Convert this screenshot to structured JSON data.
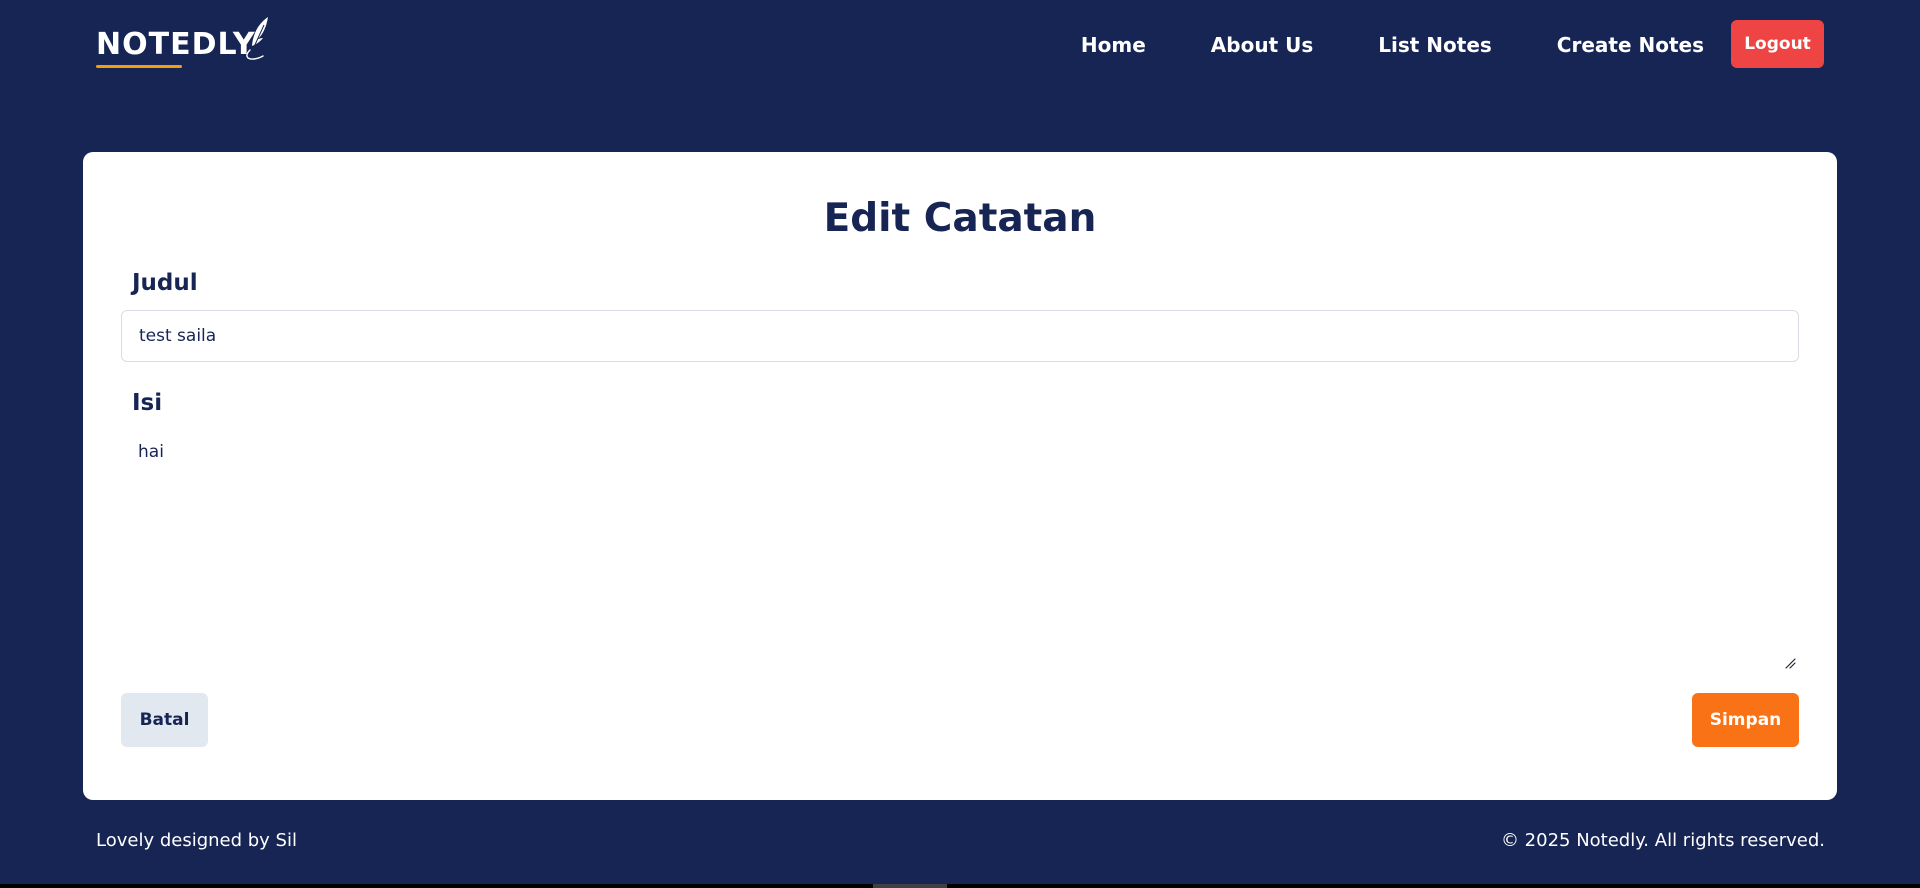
{
  "header": {
    "logo_text": "NOTEDLY",
    "nav": [
      {
        "label": "Home"
      },
      {
        "label": "About Us"
      },
      {
        "label": "List Notes"
      },
      {
        "label": "Create Notes"
      }
    ],
    "logout_label": "Logout"
  },
  "form": {
    "title": "Edit Catatan",
    "judul_label": "Judul",
    "judul_value": "test saila",
    "isi_label": "Isi",
    "isi_value": "hai",
    "cancel_label": "Batal",
    "save_label": "Simpan"
  },
  "footer": {
    "left_text": "Lovely designed by Sil",
    "right_text": "© 2025 Notedly. All rights reserved."
  },
  "colors": {
    "background": "#172554",
    "logout": "#ef4444",
    "save": "#f97316",
    "cancel": "#e2e8f0",
    "logo_underline": "#f59e0b"
  },
  "icons": {
    "logo_decoration": "quill-icon",
    "textarea_resize": "resize-handle-icon"
  }
}
